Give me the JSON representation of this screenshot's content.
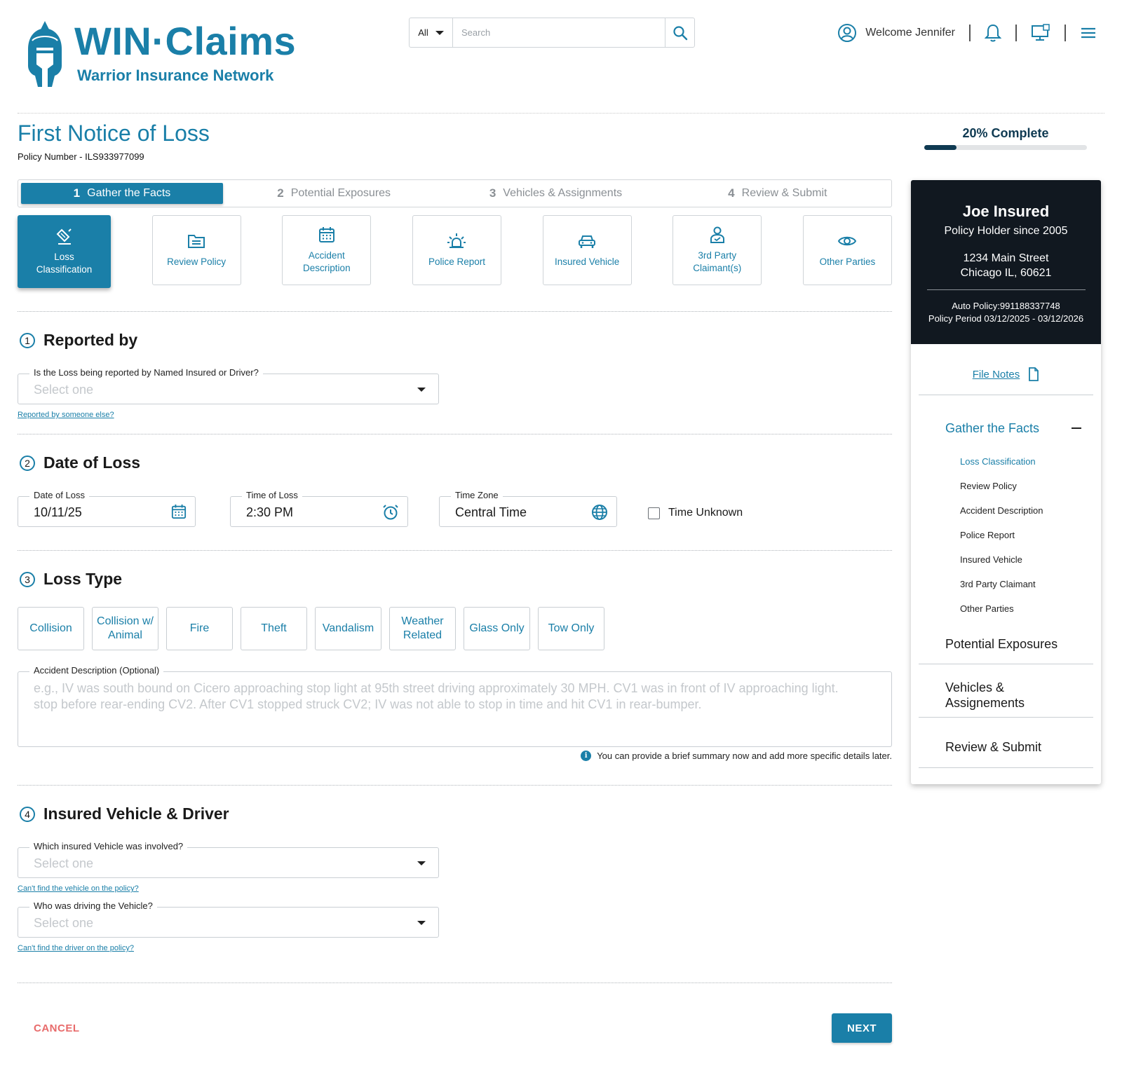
{
  "brand": {
    "title": "WIN·Claims",
    "subtitle": "Warrior Insurance Network",
    "color": "#1a7fa8"
  },
  "search": {
    "scope": "All",
    "placeholder": "Search"
  },
  "user": {
    "welcome": "Welcome Jennifer"
  },
  "page": {
    "title": "First Notice of Loss",
    "policy_label": "Policy Number  -  ILS933977099"
  },
  "progress": {
    "label": "20% Complete",
    "percent": 20
  },
  "steps": [
    {
      "num": "1",
      "label": "Gather the Facts",
      "active": true
    },
    {
      "num": "2",
      "label": "Potential Exposures"
    },
    {
      "num": "3",
      "label": "Vehicles & Assignments"
    },
    {
      "num": "4",
      "label": "Review & Submit"
    }
  ],
  "cards": [
    {
      "label": "Loss\nClassification",
      "icon": "stamp-icon",
      "active": true
    },
    {
      "label": "Review Policy",
      "icon": "document-list-icon"
    },
    {
      "label": "Accident\nDescription",
      "icon": "calendar-icon"
    },
    {
      "label": "Police Report",
      "icon": "siren-icon"
    },
    {
      "label": "Insured Vehicle",
      "icon": "car-icon"
    },
    {
      "label": "3rd Party\nClaimant(s)",
      "icon": "person-icon"
    },
    {
      "label": "Other Parties",
      "icon": "eye-icon"
    }
  ],
  "reported_by": {
    "num": "1",
    "title": "Reported by",
    "label": "Is the Loss being reported by Named Insured or Driver?",
    "placeholder": "Select one",
    "link": "Reported by someone else?"
  },
  "date_of_loss": {
    "num": "2",
    "title": "Date of Loss",
    "date_label": "Date of Loss",
    "date_value": "10/11/25",
    "time_label": "Time of Loss",
    "time_value": "2:30 PM",
    "tz_label": "Time Zone",
    "tz_value": "Central Time",
    "unknown_label": "Time Unknown"
  },
  "loss_type": {
    "num": "3",
    "title": "Loss Type",
    "options": [
      "Collision",
      "Collision w/\nAnimal",
      "Fire",
      "Theft",
      "Vandalism",
      "Weather\nRelated",
      "Glass Only",
      "Tow Only"
    ],
    "desc_label": "Accident Description (Optional)",
    "desc_placeholder": "e.g., IV was south bound on Cicero approaching stop light at 95th street driving approximately 30 MPH.  CV1 was in front of IV approaching light. stop before rear-ending CV2.  After CV1 stopped struck CV2; IV was not able to stop in time and hit CV1 in rear-bumper.",
    "hint": "You can provide a brief summary now and add more specific details later."
  },
  "vehicle_driver": {
    "num": "4",
    "title": "Insured Vehicle & Driver",
    "vehicle_label": "Which insured Vehicle was involved?",
    "vehicle_placeholder": "Select one",
    "vehicle_link": "Can't find the vehicle on the policy?",
    "driver_label": "Who was driving the Vehicle?",
    "driver_placeholder": "Select one",
    "driver_link": "Can't find the driver on the policy?"
  },
  "actions": {
    "cancel": "CANCEL",
    "next": "NEXT"
  },
  "insured": {
    "name": "Joe Insured",
    "since": "Policy Holder since 2005",
    "street": "1234 Main Street",
    "city": "Chicago IL, 60621",
    "policy": "Auto Policy:991188337748",
    "period": "Policy Period 03/12/2025 - 03/12/2026"
  },
  "sidebar": {
    "file_notes": "File Notes",
    "group": "Gather the Facts",
    "sub_items": [
      "Loss Classification",
      "Review Policy",
      "Accident Description",
      "Police Report",
      "Insured Vehicle",
      "3rd Party Claimant",
      "Other Parties"
    ],
    "items": [
      "Potential Exposures",
      "Vehicles &\nAssignements",
      "Review & Submit"
    ]
  }
}
